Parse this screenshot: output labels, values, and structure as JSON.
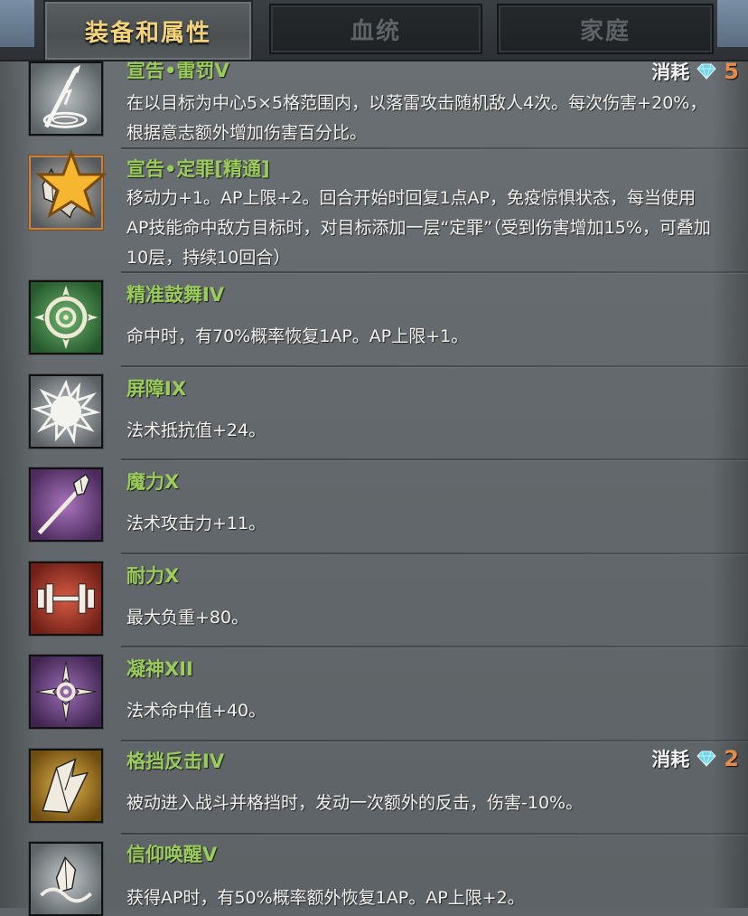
{
  "tabs": [
    {
      "label": "装备和属性",
      "active": true
    },
    {
      "label": "血统",
      "active": false
    },
    {
      "label": "家庭",
      "active": false
    }
  ],
  "skills": [
    {
      "name": "宣告•雷罚V",
      "desc": "在以目标为中心5×5格范围内，以落雷攻击随机敌人4次。每次伤害+20%，根据意志额外增加伤害百分比。",
      "cost_label": "消耗",
      "cost_value": "5",
      "icon": "thunder-spear-icon",
      "icon_bg": "#7c8489"
    },
    {
      "name": "宣告•定罪[精通]",
      "desc": "移动力+1。AP上限+2。回合开始时回复1点AP，免疫惊惧状态，每当使用AP技能命中敌方目标时，对目标添加一层“定罪”（受到伤害增加15%，可叠加10层，持续10回合）",
      "icon": "crystal-claw-icon",
      "icon_bg": "#7f8285",
      "mastered": true
    },
    {
      "name": "精准鼓舞IV",
      "desc": "命中时，有70%概率恢复1AP。AP上限+1。",
      "icon": "crosshair-icon",
      "icon_bg": "#3f8a47"
    },
    {
      "name": "屏障IX",
      "desc": "法术抵抗值+24。",
      "icon": "shatter-barrier-icon",
      "icon_bg": "#838a8c"
    },
    {
      "name": "魔力X",
      "desc": "法术攻击力+11。",
      "icon": "magic-wand-icon",
      "icon_bg": "#7b4b8c"
    },
    {
      "name": "耐力X",
      "desc": "最大负重+80。",
      "icon": "dumbbell-icon",
      "icon_bg": "#a63a2c"
    },
    {
      "name": "凝神XII",
      "desc": "法术命中值+40。",
      "icon": "focus-cross-icon",
      "icon_bg": "#6e4585"
    },
    {
      "name": "格挡反击IV",
      "desc": "被动进入战斗并格挡时，发动一次额外的反击，伤害-10%。",
      "cost_label": "消耗",
      "cost_value": "2",
      "icon": "shield-counter-icon",
      "icon_bg": "#b88b2a"
    },
    {
      "name": "信仰唤醒V",
      "desc": "获得AP时，有50%概率额外恢复1AP。AP上限+2。",
      "icon": "faith-awaken-icon",
      "icon_bg": "#80878a"
    }
  ],
  "colors": {
    "skill_name": "#9acb5b",
    "description": "#f1f1ef",
    "cost_value": "#e88a4a",
    "active_tab": "#f2d27a",
    "gem": "#6fd3e8"
  }
}
